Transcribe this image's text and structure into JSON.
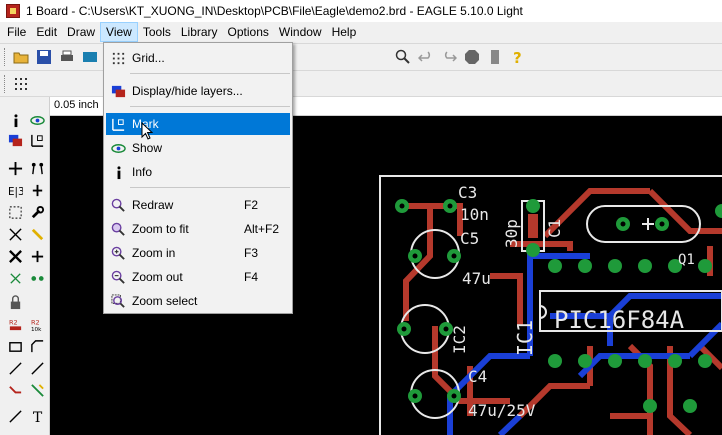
{
  "window": {
    "title": "1 Board - C:\\Users\\KT_XUONG_IN\\Desktop\\PCB\\File\\Eagle\\demo2.brd - EAGLE 5.10.0 Light"
  },
  "menubar": {
    "items": [
      {
        "label": "File"
      },
      {
        "label": "Edit"
      },
      {
        "label": "Draw"
      },
      {
        "label": "View"
      },
      {
        "label": "Tools"
      },
      {
        "label": "Library"
      },
      {
        "label": "Options"
      },
      {
        "label": "Window"
      },
      {
        "label": "Help"
      }
    ],
    "active": "View"
  },
  "coordbar": {
    "value": "0.05 inch"
  },
  "view_menu": {
    "items": [
      {
        "label": "Grid...",
        "shortcut": "",
        "icon": "grid-icon"
      },
      {
        "label": "Display/hide layers...",
        "shortcut": "",
        "icon": "layers-icon"
      },
      {
        "label": "Mark",
        "shortcut": "",
        "icon": "mark-icon",
        "highlighted": true
      },
      {
        "label": "Show",
        "shortcut": "",
        "icon": "eye-icon"
      },
      {
        "label": "Info",
        "shortcut": "",
        "icon": "info-icon"
      },
      {
        "label": "Redraw",
        "shortcut": "F2",
        "icon": "redraw-icon"
      },
      {
        "label": "Zoom to fit",
        "shortcut": "Alt+F2",
        "icon": "zoom-fit-icon"
      },
      {
        "label": "Zoom in",
        "shortcut": "F3",
        "icon": "zoom-in-icon"
      },
      {
        "label": "Zoom out",
        "shortcut": "F4",
        "icon": "zoom-out-icon"
      },
      {
        "label": "Zoom select",
        "shortcut": "",
        "icon": "zoom-select-icon"
      }
    ]
  },
  "board": {
    "labels": {
      "c3": "C3",
      "n10": "10n",
      "c5": "C5",
      "p30": "30p",
      "c1": "C1",
      "u47": "47u",
      "ic2": "IC2",
      "ic1": "IC1",
      "chip": "PIC16F84A",
      "c4": "C4",
      "u47v": "47u/25V",
      "q1": "Q1"
    }
  },
  "colors": {
    "trace_red": "#b5392c",
    "trace_blue": "#1a3fd6",
    "pad_green": "#1f9a3a",
    "outline": "#e8e8e8",
    "selection": "#0078d7"
  }
}
